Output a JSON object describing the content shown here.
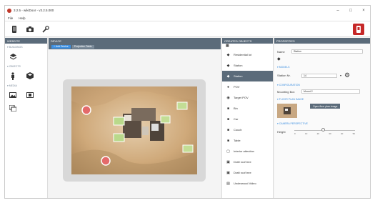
{
  "title_bar": {
    "title": "3.2.5 - wikiDoor - v3.2.5.000",
    "minimize": "–",
    "maximize": "□",
    "close": "×"
  },
  "menu": {
    "file": "File",
    "help": "Help"
  },
  "toolbar": {
    "icons": [
      "phone-icon",
      "camera-icon",
      "wrench-icon"
    ],
    "accent": "#c62828"
  },
  "website": {
    "header": "Website",
    "sec_buildings": "▾ Buildings",
    "sec_objects": "▾ Objects",
    "sec_media": "▾ Media"
  },
  "device": {
    "header": "Device",
    "tab_add": "+ Add Device",
    "tab_projection": "Projection Table"
  },
  "objects": {
    "header": "Created Objects",
    "items": [
      {
        "label": "Residential lot",
        "icon": "building-icon"
      },
      {
        "label": "Station",
        "icon": "building-icon"
      },
      {
        "label": "Station",
        "icon": "building-icon",
        "selected": true
      },
      {
        "label": "POV",
        "icon": "person-icon"
      },
      {
        "label": "Target POV",
        "icon": "eye-icon"
      },
      {
        "label": "Bin",
        "icon": "cube-icon"
      },
      {
        "label": "Car",
        "icon": "cube-icon"
      },
      {
        "label": "Couch",
        "icon": "cube-icon"
      },
      {
        "label": "Table",
        "icon": "cube-icon"
      },
      {
        "label": "Interior attention",
        "icon": "chat-icon"
      },
      {
        "label": "Draft roof tree",
        "icon": "image-icon"
      },
      {
        "label": "Draft roof tree",
        "icon": "image-icon"
      },
      {
        "label": "Underwood Video",
        "icon": "film-icon"
      }
    ]
  },
  "properties": {
    "header": "Properties",
    "name_label": "Name",
    "name_value": "Station",
    "sec_models": "▾ Models",
    "station_label": "Station Nr.",
    "station_value": "14",
    "sec_config": "▾ Configuration",
    "mounting_label": "Mounting Box",
    "mounting_value": "Mount 2",
    "sec_floor": "▾ Floor Plan Image",
    "open_button": "Open floor plan image",
    "sec_camera": "▾ Camera Perspective",
    "height_label": "Height",
    "slider_ticks": [
      "0",
      "10",
      "20",
      "30",
      "40",
      "50"
    ]
  }
}
